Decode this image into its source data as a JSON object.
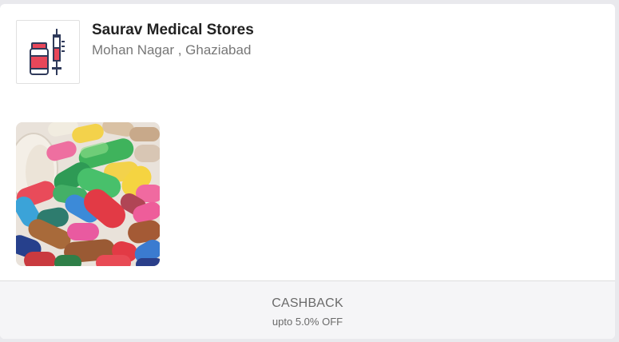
{
  "store": {
    "name": "Saurav Medical Stores",
    "location": "Mohan Nagar , Ghaziabad",
    "logo_icon": "medicine-syringe-icon"
  },
  "photo": {
    "icon": "pills-photo"
  },
  "offer": {
    "title": "CASHBACK",
    "subtitle": "upto 5.0% OFF"
  },
  "colors": {
    "background": "#e9e9ed",
    "card": "#ffffff",
    "footer": "#f5f5f7",
    "logo_red": "#e8475a",
    "logo_blue": "#2f3a5a"
  }
}
